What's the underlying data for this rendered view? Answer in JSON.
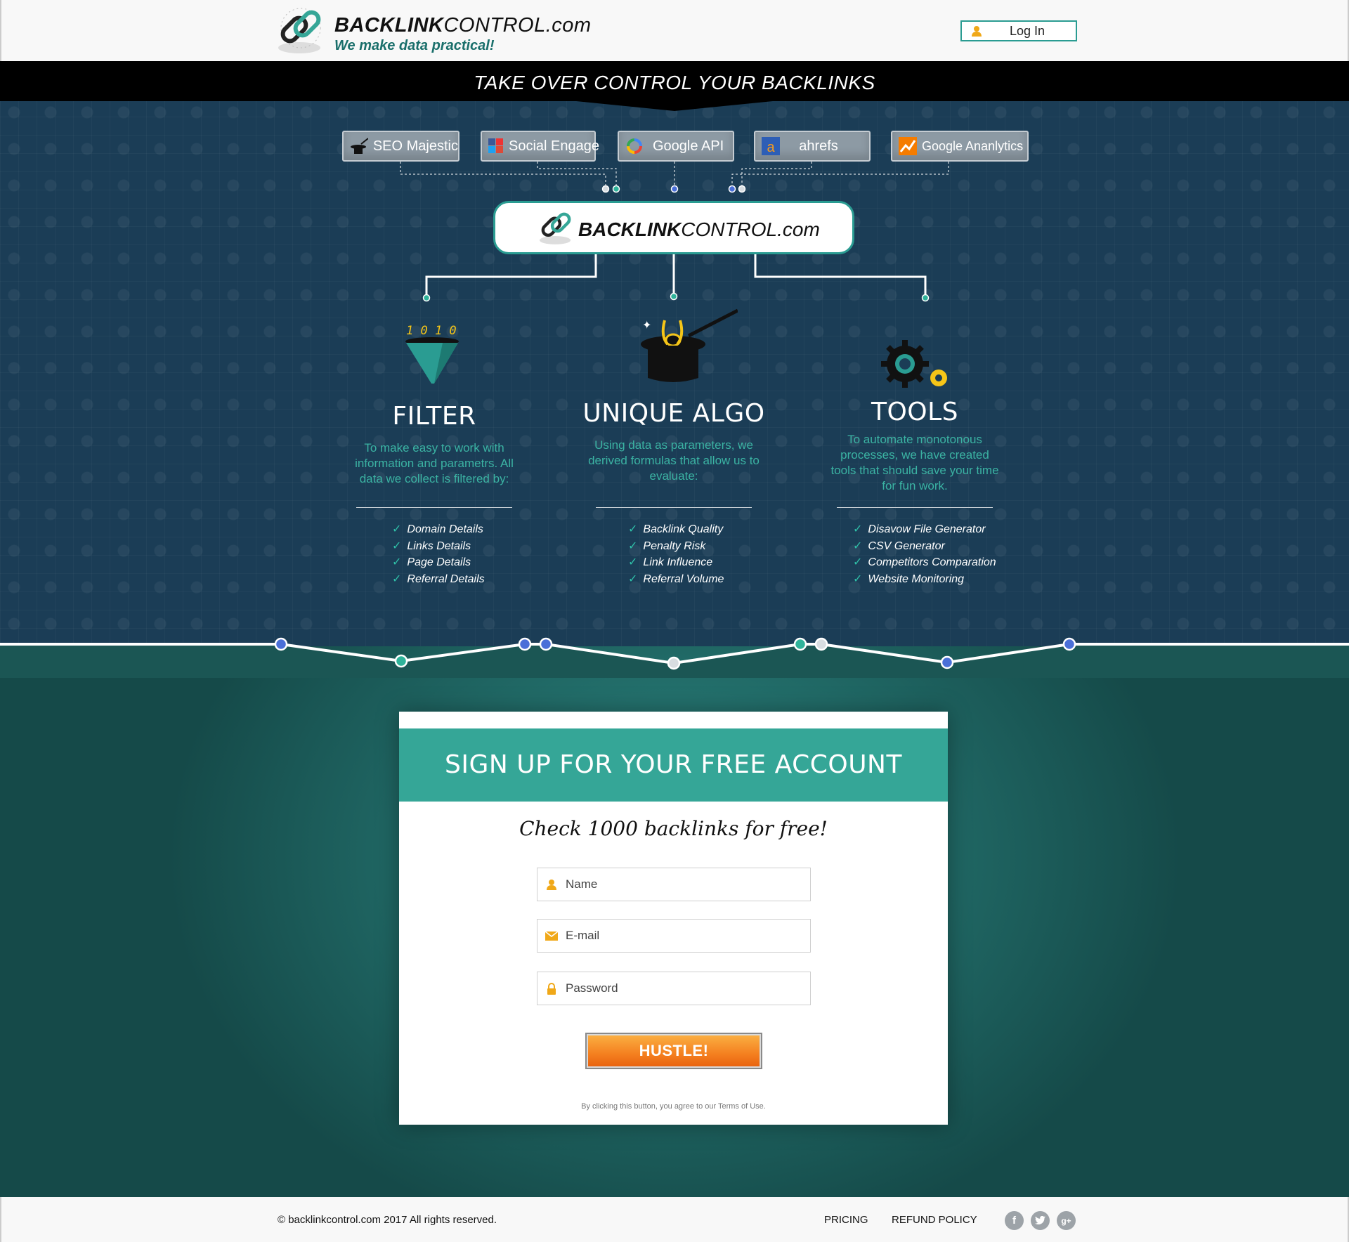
{
  "header": {
    "brand_bold": "BACKLINK",
    "brand_rest": "CONTROL.com",
    "tagline": "We make data practical!",
    "login_label": "Log In"
  },
  "banner": {
    "title": "TAKE OVER CONTROL YOUR BACKLINKS"
  },
  "sources": [
    {
      "label": "SEO Majestic",
      "icon": "magic-hat-icon"
    },
    {
      "label": "Social Engage",
      "icon": "social-collage-icon"
    },
    {
      "label": "Google API",
      "icon": "google-icon"
    },
    {
      "label": "ahrefs",
      "icon": "ahrefs-icon"
    },
    {
      "label": "Google Ananlytics",
      "icon": "analytics-chart-icon"
    }
  ],
  "center_logo": {
    "brand_bold": "BACKLINK",
    "brand_rest": "CONTROL.com"
  },
  "features": [
    {
      "title": "FILTER",
      "icon": "funnel-binary-icon",
      "description": "To make easy to work with information and parametrs. All data we collect is filtered by:",
      "items": [
        "Domain Details",
        "Links Details",
        "Page Details",
        "Referral Details"
      ]
    },
    {
      "title": "UNIQUE ALGO",
      "icon": "magic-hat-rabbit-icon",
      "description": "Using data as parameters, we derived formulas that allow us to evaluate:",
      "items": [
        "Backlink Quality",
        "Penalty Risk",
        "Link Influence",
        "Referral Volume"
      ]
    },
    {
      "title": "TOOLS",
      "icon": "gears-icon",
      "description": "To automate monotonous processes, we have created tools that should save your time for fun work.",
      "items": [
        "Disavow File Generator",
        "CSV Generator",
        "Competitors Comparation",
        "Website Monitoring"
      ]
    }
  ],
  "signup": {
    "title": "SIGN UP FOR YOUR FREE ACCOUNT",
    "subtitle": "Check 1000 backlinks for free!",
    "name_placeholder": "Name",
    "email_placeholder": "E-mail",
    "password_placeholder": "Password",
    "button_label": "HUSTLE!",
    "terms": "By clicking this button, you agree to our Terms of Use."
  },
  "footer": {
    "copyright": "© backlinkcontrol.com 2017 All rights reserved.",
    "links": [
      "PRICING",
      "REFUND POLICY"
    ],
    "social": [
      "facebook-icon",
      "twitter-icon",
      "google-plus-icon"
    ]
  },
  "colors": {
    "accent_teal": "#35a697",
    "hero_navy": "#1b3d56",
    "button_orange": "#f47f1f"
  }
}
